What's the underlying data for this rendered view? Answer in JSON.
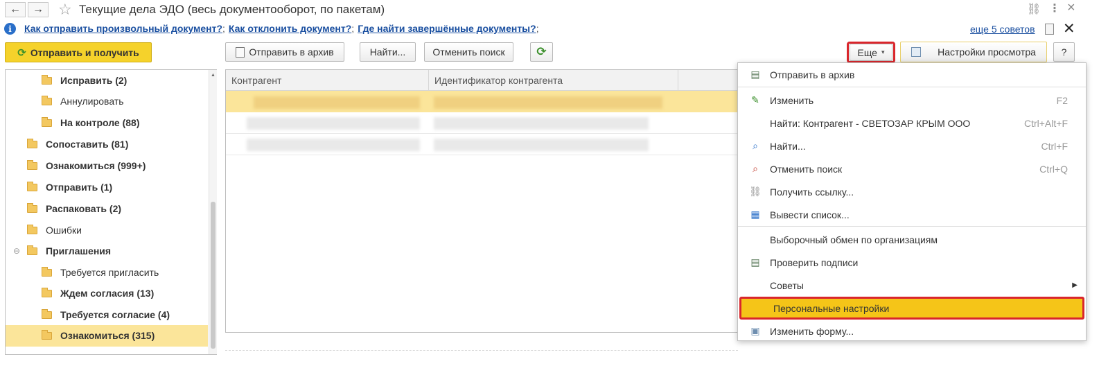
{
  "window": {
    "title": "Текущие дела ЭДО (весь документооборот, по пакетам)",
    "back_icon": "←",
    "forward_icon": "→",
    "star_icon": "☆",
    "link_icon": "⛓",
    "more_icon": "⋮",
    "close_icon": "×"
  },
  "tips": {
    "links": [
      "Как отправить произвольный документ?",
      "Как отклонить документ?",
      "Где найти завершённые документы?"
    ],
    "separator": ";",
    "more_tips": "еще 5 советов",
    "close": "✕"
  },
  "toolbar": {
    "send_receive": "Отправить и получить",
    "send_archive": "Отправить в архив",
    "find": "Найти...",
    "cancel_search": "Отменить поиск",
    "more": "Еще",
    "view_settings": "Настройки просмотра",
    "help": "?"
  },
  "tree": {
    "items": [
      {
        "label": "Исправить (2)",
        "bold": true,
        "level": 2
      },
      {
        "label": "Аннулировать",
        "bold": false,
        "level": 2
      },
      {
        "label": "На контроле (88)",
        "bold": true,
        "level": 2
      },
      {
        "label": "Сопоставить (81)",
        "bold": true,
        "level": 1
      },
      {
        "label": "Ознакомиться (999+)",
        "bold": true,
        "level": 1
      },
      {
        "label": "Отправить (1)",
        "bold": true,
        "level": 1
      },
      {
        "label": "Распаковать (2)",
        "bold": true,
        "level": 1
      },
      {
        "label": "Ошибки",
        "bold": false,
        "level": 1
      },
      {
        "label": "Приглашения",
        "bold": true,
        "level": 1
      },
      {
        "label": "Требуется пригласить",
        "bold": false,
        "level": 2
      },
      {
        "label": "Ждем согласия (13)",
        "bold": true,
        "level": 2
      },
      {
        "label": "Требуется согласие (4)",
        "bold": true,
        "level": 2
      },
      {
        "label": "Ознакомиться (315)",
        "bold": true,
        "level": 2
      }
    ]
  },
  "table": {
    "columns": [
      "Контрагент",
      "Идентификатор контрагента"
    ]
  },
  "menu": {
    "items": [
      {
        "label": "Отправить в архив",
        "key": "",
        "icon": "archive-icon"
      },
      {
        "label": "Изменить",
        "key": "F2",
        "icon": "pencil-icon"
      },
      {
        "label": "Найти: Контрагент - СВЕТОЗАР КРЫМ ООО",
        "key": "Ctrl+Alt+F",
        "icon": ""
      },
      {
        "label": "Найти...",
        "key": "Ctrl+F",
        "icon": "search-icon"
      },
      {
        "label": "Отменить поиск",
        "key": "Ctrl+Q",
        "icon": "cancel-search-icon"
      },
      {
        "label": "Получить ссылку...",
        "key": "",
        "icon": "link-icon"
      },
      {
        "label": "Вывести список...",
        "key": "",
        "icon": "list-icon"
      },
      {
        "label": "Выборочный обмен по организациям",
        "key": "",
        "icon": ""
      },
      {
        "label": "Проверить подписи",
        "key": "",
        "icon": "signature-icon"
      },
      {
        "label": "Советы",
        "key": "",
        "icon": ""
      },
      {
        "label": "Персональные настройки",
        "key": "",
        "icon": ""
      },
      {
        "label": "Изменить форму...",
        "key": "",
        "icon": "form-icon"
      }
    ]
  },
  "colors": {
    "accent_yellow": "#f5c518",
    "highlight_red": "#d9262c",
    "link_blue": "#1a4fa0"
  }
}
